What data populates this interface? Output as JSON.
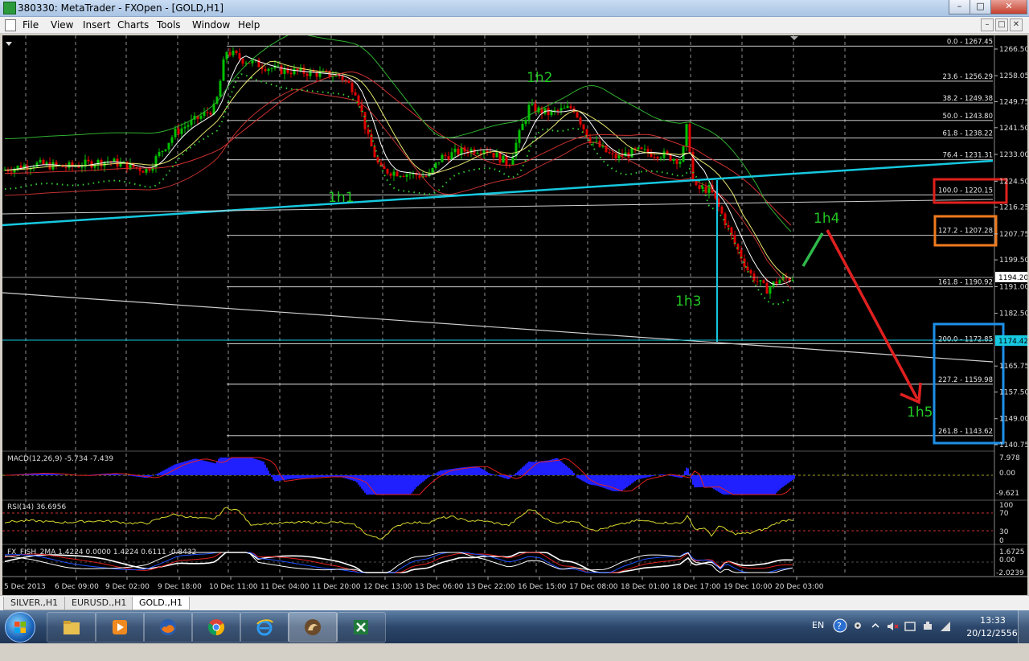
{
  "window": {
    "title": "380330: MetaTrader - FXOpen - [GOLD,H1]",
    "min_glyph": "–",
    "max_glyph": "□",
    "close_glyph": "✕"
  },
  "menu": [
    "File",
    "View",
    "Insert",
    "Charts",
    "Tools",
    "Window",
    "Help"
  ],
  "mdi_controls": [
    "–",
    "□",
    "✕"
  ],
  "colors": {
    "chart_bg": "#000000",
    "bull": "#00c000",
    "bear": "#e00000",
    "trendline": "#00c0e0",
    "fib": "#e8e8e8",
    "annotation_green": "#22c822",
    "arrow_red": "#e02020",
    "box_red": "#e0201c",
    "box_orange": "#f07a1e",
    "box_blue": "#1e90e8"
  },
  "chart": {
    "symbol": "GOLD",
    "timeframe": "H1",
    "price_scale": [
      "1266.50",
      "1258.05",
      "1249.75",
      "1241.50",
      "1233.00",
      "1224.50",
      "1216.25",
      "1207.75",
      "1199.50",
      "1191.00",
      "1182.50",
      "1165.75",
      "1157.50",
      "1149.00",
      "1140.75"
    ],
    "current_price": "1194.20",
    "line_price": "1174.42",
    "fib_levels": [
      {
        "label": "0.0 - 1267.45"
      },
      {
        "label": "23.6 - 1256.29"
      },
      {
        "label": "38.2 - 1249.38"
      },
      {
        "label": "50.0 - 1243.80"
      },
      {
        "label": "61.8 - 1238.22"
      },
      {
        "label": "76.4 - 1231.31"
      },
      {
        "label": "100.0 - 1220.15"
      },
      {
        "label": "127.2 - 1207.28"
      },
      {
        "label": "161.8 - 1190.92"
      },
      {
        "label": "200.0 - 1172.85"
      },
      {
        "label": "227.2 - 1159.98"
      },
      {
        "label": "261.8 - 1143.62"
      }
    ],
    "annotations": [
      "1h1",
      "1h2",
      "1h3",
      "1h4",
      "1h5"
    ],
    "time_axis": [
      "5 Dec 2013",
      "6 Dec 09:00",
      "9 Dec 02:00",
      "9 Dec 18:00",
      "10 Dec 11:00",
      "11 Dec 04:00",
      "11 Dec 20:00",
      "12 Dec 13:00",
      "13 Dec 06:00",
      "13 Dec 22:00",
      "16 Dec 15:00",
      "17 Dec 08:00",
      "18 Dec 01:00",
      "18 Dec 17:00",
      "19 Dec 10:00",
      "20 Dec 03:00"
    ]
  },
  "macd": {
    "label": "MACD(12,26,9) -5.734 -7.439",
    "scale": [
      "7.978",
      "0.00",
      "-9.621"
    ]
  },
  "rsi": {
    "label": "RSI(14) 36.6956",
    "scale": [
      "100",
      "70",
      "30",
      "0"
    ]
  },
  "fish": {
    "label": "FX_FISH_2MA 1.4224 0.0000 1.4224 0.6111 -0.8432",
    "scale": [
      "1.6725",
      "0.00",
      "-2.0239"
    ]
  },
  "tabs": [
    "SILVER.,H1",
    "EURUSD.,H1",
    "GOLD.,H1"
  ],
  "taskbar": {
    "apps": [
      "explorer-icon",
      "media-player-icon",
      "firefox-icon",
      "chrome-icon",
      "ie-icon",
      "metatrader-icon",
      "excel-icon"
    ],
    "lang": "EN",
    "time": "13:33",
    "date": "20/12/2556"
  }
}
